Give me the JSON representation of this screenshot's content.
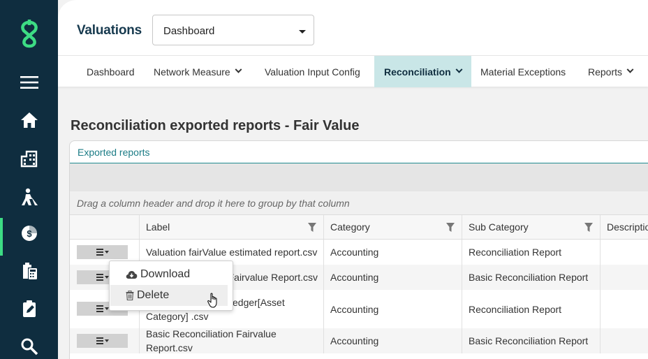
{
  "app": {
    "title": "Valuations",
    "dashboard_select": "Dashboard"
  },
  "sidebar": {
    "items": [
      {
        "icon": "menu-icon"
      },
      {
        "icon": "home-icon"
      },
      {
        "icon": "building-icon"
      },
      {
        "icon": "worker-icon"
      },
      {
        "icon": "money-chart-icon",
        "active": true
      },
      {
        "icon": "calculator-icon"
      },
      {
        "icon": "clipboard-edit-icon"
      },
      {
        "icon": "search-icon"
      }
    ]
  },
  "nav": {
    "tabs": [
      {
        "label": "Dashboard"
      },
      {
        "label": "Network Measure"
      },
      {
        "label": "Valuation Input Config"
      },
      {
        "label": "Reconciliation",
        "active": true
      },
      {
        "label": "Material Exceptions"
      },
      {
        "label": "Reports"
      }
    ]
  },
  "page": {
    "title": "Reconciliation exported reports - Fair Value"
  },
  "panel": {
    "header": "Exported reports",
    "group_hint": "Drag a column header and drop it here to group by that column",
    "columns": [
      "Label",
      "Category",
      "Sub Category",
      "Descriptio"
    ],
    "rows": [
      {
        "label": "Valuation fairValue estimated report.csv",
        "category": "Accounting",
        "sub_category": "Reconciliation Report"
      },
      {
        "label": "Fairvalue Report.csv",
        "category": "Accounting",
        "sub_category": "Basic Reconciliation Report"
      },
      {
        "label_line1": "edger[Asset",
        "label_line2": "Category] .csv",
        "category": "Accounting",
        "sub_category": "Reconciliation Report"
      },
      {
        "label": "Basic Reconciliation Fairvalue Report.csv",
        "category": "Accounting",
        "sub_category": "Basic Reconciliation Report"
      }
    ]
  },
  "context_menu": {
    "items": [
      {
        "label": "Download",
        "icon": "cloud-download-icon"
      },
      {
        "label": "Delete",
        "icon": "trash-icon"
      }
    ]
  },
  "colors": {
    "sidebar": "#0f2d3f",
    "accent": "#3ddc84",
    "active_tab": "#c9e6e7",
    "teal": "#1c7c86"
  }
}
